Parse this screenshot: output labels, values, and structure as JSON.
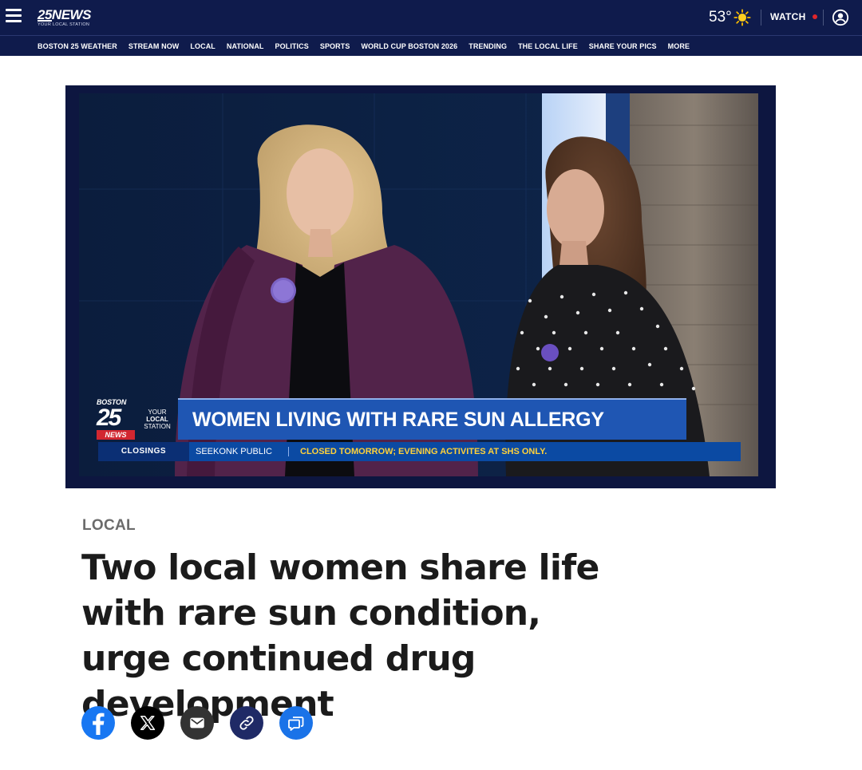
{
  "header": {
    "logo": {
      "brand": "25NEWS",
      "tagline": "YOUR LOCAL STATION"
    },
    "weather": {
      "temperature": "53°",
      "icon": "sun-icon"
    },
    "watch_label": "WATCH",
    "nav": [
      "BOSTON 25 WEATHER",
      "STREAM NOW",
      "LOCAL",
      "NATIONAL",
      "POLITICS",
      "SPORTS",
      "WORLD CUP BOSTON 2026",
      "TRENDING",
      "THE LOCAL LIFE",
      "SHARE YOUR PICS",
      "MORE"
    ]
  },
  "video": {
    "brand": {
      "city": "BOSTON",
      "number": "25",
      "tagline_1": "YOUR",
      "tagline_2": "LOCAL",
      "tagline_3": "STATION",
      "news": "NEWS"
    },
    "headline": "WOMEN LIVING WITH RARE SUN ALLERGY",
    "ticker": {
      "label": "CLOSINGS",
      "place": "SEEKONK PUBLIC",
      "message": "CLOSED TOMORROW; EVENING ACTIVITES AT SHS ONLY."
    }
  },
  "article": {
    "section": "LOCAL",
    "title": "Two local women share life with rare sun condition, urge continued drug development",
    "share": [
      {
        "name": "facebook-share-button",
        "icon": "facebook-icon",
        "color": "#1877f2"
      },
      {
        "name": "x-share-button",
        "icon": "x-icon",
        "color": "#000000"
      },
      {
        "name": "email-share-button",
        "icon": "email-icon",
        "color": "#333333"
      },
      {
        "name": "copy-link-button",
        "icon": "link-icon",
        "color": "#1f2a66"
      },
      {
        "name": "comments-button",
        "icon": "comment-icon",
        "color": "#1a73e8"
      }
    ]
  }
}
